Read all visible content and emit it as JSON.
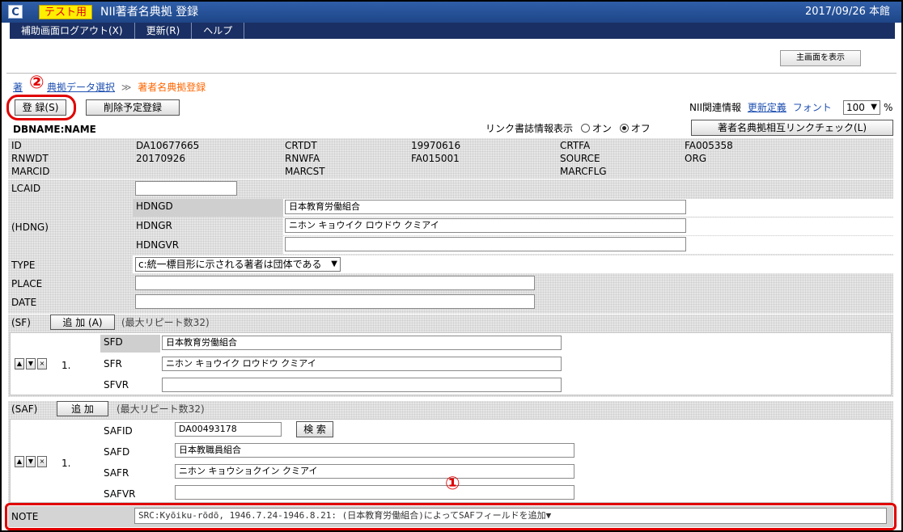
{
  "window": {
    "app_icon": "C",
    "test_badge": "テスト用",
    "title": "NII著者名典拠 登録",
    "date_location": "2017/09/26 本館"
  },
  "menu": [
    "補助画面ログアウト(X)",
    "更新(R)",
    "ヘルプ"
  ],
  "main_screen_button": "主画面を表示",
  "breadcrumb": {
    "link1": "著",
    "link2": "典拠データ選択",
    "sep": "≫",
    "current": "著者名典拠登録"
  },
  "annotations": {
    "mark1": "①",
    "mark2": "②"
  },
  "toolbar": {
    "register_button": "登 録(S)",
    "delete_schedule_button": "削除予定登録"
  },
  "nii_info": {
    "label": "NII関連情報",
    "update_def_link": "更新定義",
    "font_label": "フォント",
    "font_value": "100",
    "percent": "%"
  },
  "link_display": {
    "label": "リンク書誌情報表示",
    "on": "オン",
    "off": "オフ",
    "selected": "off"
  },
  "link_check_button": "著者名典拠相互リンクチェック(L)",
  "dbname": "DBNAME:NAME",
  "record": {
    "id_label": "ID",
    "id": "DA10677665",
    "crtdt_label": "CRTDT",
    "crtdt": "19970616",
    "crtfa_label": "CRTFA",
    "crtfa": "FA005358",
    "rnwdt_label": "RNWDT",
    "rnwdt": "20170926",
    "rnwfa_label": "RNWFA",
    "rnwfa": "FA015001",
    "source_label": "SOURCE",
    "source": "ORG",
    "marcid_label": "MARCID",
    "marcst_label": "MARCST",
    "marcflg_label": "MARCFLG",
    "lcaid_label": "LCAID",
    "lcaid": ""
  },
  "hdng": {
    "label": "(HDNG)",
    "hdngd_label": "HDNGD",
    "hdngd": "日本教育労働組合",
    "hdngr_label": "HDNGR",
    "hdngr": "ニホン キョウイク ロウドウ クミアイ",
    "hdngvr_label": "HDNGVR",
    "hdngvr": ""
  },
  "type": {
    "label": "TYPE",
    "value": "c:統一標目形に示される著者は団体である"
  },
  "place": {
    "label": "PLACE",
    "value": ""
  },
  "date": {
    "label": "DATE",
    "value": ""
  },
  "sf": {
    "label": "(SF)",
    "add_button": "追 加 (A)",
    "max_repeat": "(最大リピート数32)",
    "index": "1.",
    "sfd_label": "SFD",
    "sfd": "日本教育労働組合",
    "sfr_label": "SFR",
    "sfr": "ニホン キョウイク ロウドウ クミアイ",
    "sfvr_label": "SFVR",
    "sfvr": ""
  },
  "saf": {
    "label": "(SAF)",
    "add_button": "追 加",
    "max_repeat": "(最大リピート数32)",
    "index": "1.",
    "safid_label": "SAFID",
    "safid": "DA00493178",
    "search_button": "検 索",
    "safd_label": "SAFD",
    "safd": "日本教職員組合",
    "safr_label": "SAFR",
    "safr": "ニホン キョウショクイン クミアイ",
    "safvr_label": "SAFVR",
    "safvr": ""
  },
  "note": {
    "label": "NOTE",
    "value": "SRC:Kyōiku-rōdō, 1946.7.24-1946.8.21: (日本教育労働組合)によってSAFフィールドを追加▼"
  }
}
